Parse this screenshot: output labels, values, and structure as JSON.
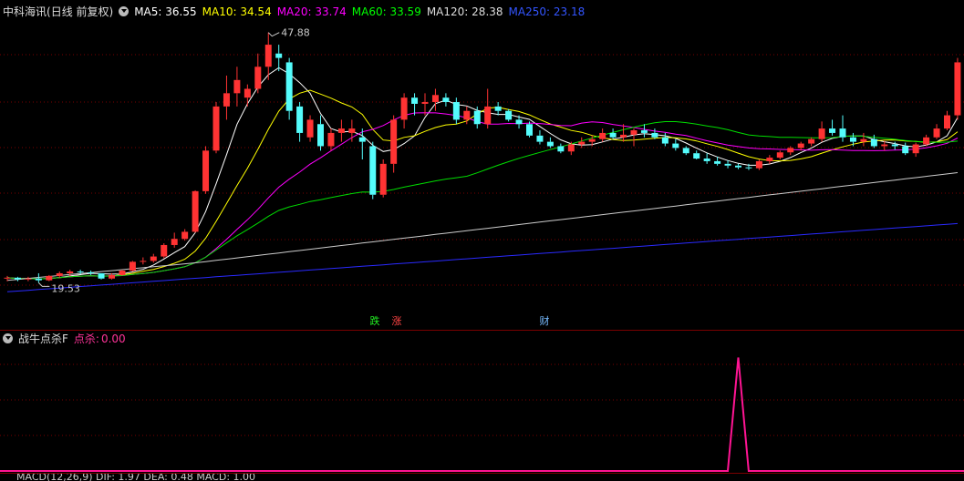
{
  "header": {
    "stock_name": "中科海讯",
    "mode": "(日线 前复权)",
    "ma5": {
      "label": "MA5:",
      "value": "36.55",
      "color": "#ffffff"
    },
    "ma10": {
      "label": "MA10:",
      "value": "34.54",
      "color": "#ffff00"
    },
    "ma20": {
      "label": "MA20:",
      "value": "33.74",
      "color": "#ff00ff"
    },
    "ma60": {
      "label": "MA60:",
      "value": "33.59",
      "color": "#00ff00"
    },
    "ma120": {
      "label": "MA120:",
      "value": "28.38",
      "color": "#dddddd"
    },
    "ma250": {
      "label": "MA250:",
      "value": "23.18",
      "color": "#3333ff"
    }
  },
  "annotations": {
    "high": "47.88",
    "low": "19.53"
  },
  "markers": [
    {
      "text": "跌",
      "fg": "#00ff00",
      "bg": "#0b3d0b"
    },
    {
      "text": "涨",
      "fg": "#ff4040",
      "bg": "#4a0c0c"
    },
    {
      "text": "财",
      "fg": "#66aaff",
      "bg": "#0c2a4a"
    }
  ],
  "sub_header": {
    "name": "战牛点杀F",
    "series_label": "点杀:",
    "series_value": "0.00",
    "color": "#ff3399"
  },
  "bottom_header": {
    "text": "MACD(12,26,9) DIF: 1.97 DEA: 0.48 MACD: 1.00"
  },
  "colors": {
    "up": "#ff3333",
    "down": "#54fcfc",
    "grid": "#7a0000",
    "spike": "#ff1493"
  },
  "chart_data": {
    "type": "candlestick",
    "ohlc": [
      [
        20.0,
        20.3,
        19.7,
        20.1
      ],
      [
        20.1,
        20.2,
        19.7,
        19.9
      ],
      [
        19.9,
        20.2,
        19.7,
        20.0
      ],
      [
        20.0,
        20.6,
        19.53,
        19.8
      ],
      [
        19.8,
        20.4,
        19.7,
        20.3
      ],
      [
        20.3,
        20.8,
        20.1,
        20.6
      ],
      [
        20.6,
        21.0,
        20.3,
        20.8
      ],
      [
        20.8,
        21.0,
        20.5,
        20.7
      ],
      [
        20.7,
        20.9,
        20.4,
        20.6
      ],
      [
        20.6,
        20.6,
        19.9,
        20.0
      ],
      [
        20.0,
        20.6,
        19.9,
        20.4
      ],
      [
        20.4,
        21.0,
        20.3,
        20.9
      ],
      [
        20.9,
        22.0,
        20.8,
        21.9
      ],
      [
        21.9,
        22.4,
        21.6,
        22.0
      ],
      [
        22.0,
        22.8,
        21.8,
        22.5
      ],
      [
        22.5,
        24.0,
        22.3,
        23.8
      ],
      [
        23.8,
        25.2,
        23.5,
        24.5
      ],
      [
        24.5,
        25.6,
        24.3,
        25.3
      ],
      [
        25.3,
        30.0,
        25.2,
        29.9
      ],
      [
        29.9,
        35.0,
        29.6,
        34.5
      ],
      [
        34.5,
        40.0,
        34.2,
        39.5
      ],
      [
        39.5,
        43.0,
        38.0,
        41.0
      ],
      [
        41.0,
        44.0,
        39.5,
        42.5
      ],
      [
        40.5,
        42.0,
        39.5,
        41.5
      ],
      [
        41.5,
        45.5,
        41.0,
        44.0
      ],
      [
        44.0,
        47.88,
        42.5,
        46.5
      ],
      [
        45.5,
        46.5,
        43.5,
        45.0
      ],
      [
        44.5,
        45.0,
        38.0,
        39.0
      ],
      [
        39.5,
        40.0,
        35.5,
        36.5
      ],
      [
        36.0,
        38.5,
        35.5,
        38.0
      ],
      [
        37.5,
        38.5,
        34.5,
        35.0
      ],
      [
        35.0,
        37.0,
        34.5,
        36.5
      ],
      [
        36.5,
        38.0,
        35.5,
        37.0
      ],
      [
        36.5,
        38.0,
        35.5,
        37.0
      ],
      [
        36.0,
        37.0,
        33.5,
        35.5
      ],
      [
        35.0,
        35.5,
        29.0,
        29.5
      ],
      [
        29.5,
        33.5,
        29.2,
        33.0
      ],
      [
        33.0,
        38.5,
        32.0,
        38.0
      ],
      [
        38.0,
        41.0,
        37.0,
        40.5
      ],
      [
        40.5,
        41.0,
        38.5,
        39.8
      ],
      [
        39.8,
        41.0,
        38.5,
        40.0
      ],
      [
        40.0,
        41.5,
        39.0,
        40.8
      ],
      [
        40.5,
        41.0,
        39.5,
        40.0
      ],
      [
        40.0,
        40.5,
        37.5,
        38.0
      ],
      [
        38.0,
        39.5,
        37.5,
        39.0
      ],
      [
        39.0,
        39.5,
        37.0,
        37.5
      ],
      [
        37.5,
        41.5,
        37.0,
        39.5
      ],
      [
        39.5,
        40.0,
        38.5,
        39.0
      ],
      [
        39.0,
        39.2,
        37.8,
        38.0
      ],
      [
        38.0,
        38.5,
        37.0,
        37.5
      ],
      [
        37.5,
        37.8,
        36.0,
        36.2
      ],
      [
        36.2,
        36.8,
        35.2,
        35.5
      ],
      [
        35.5,
        36.0,
        34.8,
        35.0
      ],
      [
        35.0,
        35.3,
        34.2,
        34.4
      ],
      [
        34.4,
        35.5,
        34.0,
        35.2
      ],
      [
        35.2,
        36.0,
        34.8,
        35.5
      ],
      [
        35.5,
        36.2,
        35.0,
        35.8
      ],
      [
        35.8,
        37.0,
        35.5,
        36.5
      ],
      [
        36.5,
        37.0,
        35.8,
        36.0
      ],
      [
        36.0,
        37.5,
        35.5,
        36.3
      ],
      [
        36.3,
        37.0,
        35.0,
        36.8
      ],
      [
        36.8,
        37.5,
        36.0,
        36.5
      ],
      [
        36.5,
        37.0,
        35.8,
        36.0
      ],
      [
        36.0,
        36.5,
        35.0,
        35.3
      ],
      [
        35.3,
        35.8,
        34.5,
        34.8
      ],
      [
        34.8,
        35.0,
        34.0,
        34.2
      ],
      [
        34.2,
        34.5,
        33.5,
        33.6
      ],
      [
        33.6,
        34.2,
        33.0,
        33.3
      ],
      [
        33.3,
        33.8,
        32.8,
        33.0
      ],
      [
        33.0,
        33.4,
        32.5,
        32.8
      ],
      [
        32.8,
        33.0,
        32.4,
        32.6
      ],
      [
        32.6,
        33.0,
        32.3,
        32.5
      ],
      [
        32.5,
        33.5,
        32.3,
        33.3
      ],
      [
        33.3,
        34.0,
        33.0,
        33.7
      ],
      [
        33.7,
        34.5,
        33.5,
        34.3
      ],
      [
        34.3,
        35.0,
        34.0,
        34.8
      ],
      [
        34.8,
        35.5,
        34.5,
        35.3
      ],
      [
        35.3,
        36.0,
        35.0,
        35.8
      ],
      [
        35.8,
        37.8,
        35.5,
        37.0
      ],
      [
        37.0,
        38.0,
        36.2,
        36.5
      ],
      [
        37.0,
        38.5,
        35.5,
        36.0
      ],
      [
        36.0,
        36.5,
        35.0,
        35.5
      ],
      [
        35.5,
        36.5,
        35.0,
        35.8
      ],
      [
        35.8,
        36.3,
        34.8,
        35.0
      ],
      [
        35.0,
        35.6,
        34.5,
        35.2
      ],
      [
        35.2,
        35.5,
        34.6,
        35.0
      ],
      [
        35.0,
        35.4,
        34.0,
        34.2
      ],
      [
        34.2,
        35.4,
        33.8,
        35.2
      ],
      [
        35.2,
        36.3,
        35.0,
        36.0
      ],
      [
        36.0,
        37.5,
        35.8,
        37.0
      ],
      [
        37.0,
        39.0,
        36.8,
        38.5
      ],
      [
        38.5,
        45.0,
        38.0,
        44.5
      ]
    ],
    "spike_index": 70,
    "spike_value": 1.0,
    "sub_ylim": [
      0,
      1.1
    ],
    "ylim": [
      17.5,
      49.5
    ]
  }
}
